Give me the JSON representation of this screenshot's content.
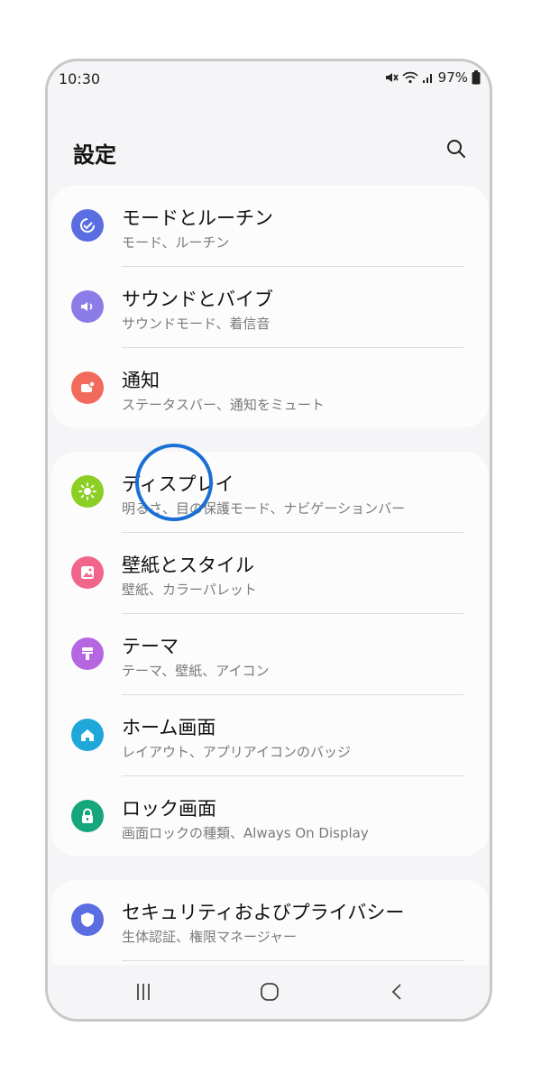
{
  "status": {
    "time": "10:30",
    "battery": "97%"
  },
  "header": {
    "title": "設定"
  },
  "group1": [
    {
      "title": "モードとルーチン",
      "subtitle": "モード、ルーチン",
      "icon": "modes-routines-icon",
      "color": "#5b6ee1"
    },
    {
      "title": "サウンドとバイブ",
      "subtitle": "サウンドモード、着信音",
      "icon": "speaker-icon",
      "color": "#8b7ce8"
    },
    {
      "title": "通知",
      "subtitle": "ステータスバー、通知をミュート",
      "icon": "notification-icon",
      "color": "#f26a5c"
    }
  ],
  "group2": [
    {
      "title": "ディスプレイ",
      "subtitle": "明るさ、目の保護モード、ナビゲーションバー",
      "icon": "sun-icon",
      "color": "#8ccf24"
    },
    {
      "title": "壁紙とスタイル",
      "subtitle": "壁紙、カラーパレット",
      "icon": "wallpaper-icon",
      "color": "#f0668a"
    },
    {
      "title": "テーマ",
      "subtitle": "テーマ、壁紙、アイコン",
      "icon": "paint-brush-icon",
      "color": "#b566e0"
    },
    {
      "title": "ホーム画面",
      "subtitle": "レイアウト、アプリアイコンのバッジ",
      "icon": "home-icon",
      "color": "#1ea7d8"
    },
    {
      "title": "ロック画面",
      "subtitle": "画面ロックの種類、Always On Display",
      "icon": "lock-icon",
      "color": "#16a67c"
    }
  ],
  "group3": [
    {
      "title": "セキュリティおよびプライバシー",
      "subtitle": "生体認証、権限マネージャー",
      "icon": "shield-icon",
      "color": "#5b6ee1"
    }
  ]
}
